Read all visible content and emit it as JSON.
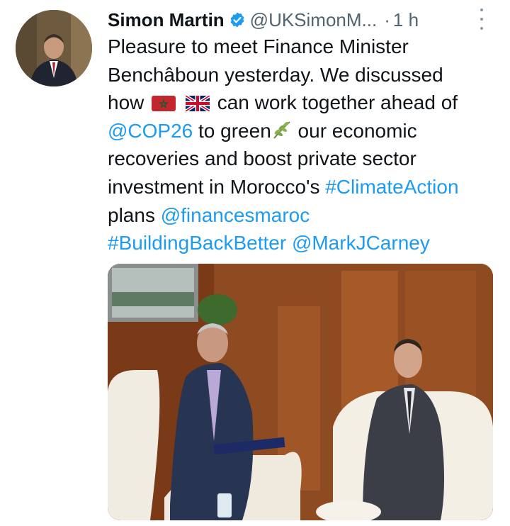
{
  "tweet": {
    "author_name": "Simon Martin",
    "author_handle": "@UKSimonM...",
    "separator": "·",
    "time": "1 h",
    "lines": [
      [
        {
          "t": "Pleasure to meet Finance Minister"
        }
      ],
      [
        {
          "t": "Benchâboun yesterday. We discussed"
        }
      ],
      [
        {
          "t": "how "
        },
        {
          "flag": "morocco-flag-icon"
        },
        {
          "t": " "
        },
        {
          "flag": "uk-flag-icon"
        },
        {
          "t": " can work together ahead of"
        }
      ],
      [
        {
          "t": "@COP26",
          "link": true
        },
        {
          "t": " to green"
        },
        {
          "emoji": "herb-icon"
        },
        {
          "t": " our economic"
        }
      ],
      [
        {
          "t": "recoveries and boost private sector"
        }
      ],
      [
        {
          "t": "investment in Morocco's "
        },
        {
          "t": "#ClimateAction",
          "link": true
        }
      ],
      [
        {
          "t": "plans "
        },
        {
          "t": "@financesmaroc",
          "link": true
        }
      ],
      [
        {
          "t": "#BuildingBackBetter",
          "link": true
        },
        {
          "t": " "
        },
        {
          "t": "@MarkJCarney",
          "link": true
        }
      ]
    ]
  },
  "colors": {
    "link": "#1d9bf0",
    "secondary": "#536471",
    "verified": "#1d9bf0"
  },
  "icons": {
    "verified": "verified-badge-icon",
    "more": "more-options-icon"
  }
}
